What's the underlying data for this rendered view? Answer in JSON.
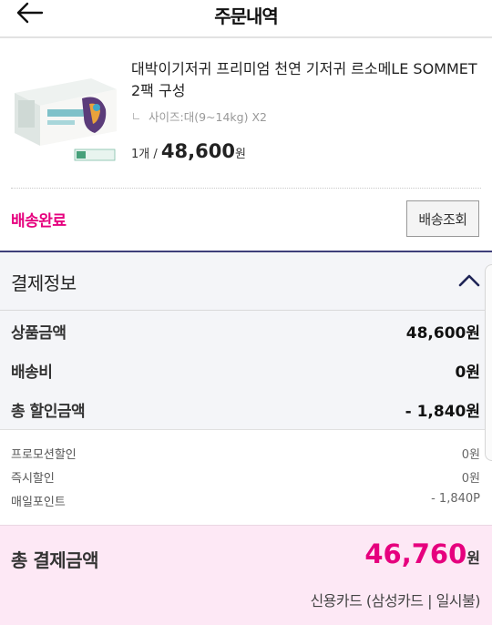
{
  "header": {
    "title": "주문내역",
    "back_icon": "arrow-left-icon"
  },
  "product": {
    "name": "대박이기저귀 프리미엄 천연 기저귀 르소메LE SOMMET 2팩 구성",
    "option": "사이즈:대(9~14kg) X2",
    "quantity": "1개 /",
    "price": "48,600",
    "price_unit": "원"
  },
  "shipping": {
    "status": "배송완료",
    "track_button": "배송조회"
  },
  "payment": {
    "section_title": "결제정보",
    "toggle_icon": "chevron-up-icon",
    "summary": [
      {
        "label": "상품금액",
        "value": "48,600원"
      },
      {
        "label": "배송비",
        "value": "0원"
      },
      {
        "label": "총 할인금액",
        "value": "- 1,840원"
      }
    ],
    "details": [
      {
        "label": "프로모션할인",
        "value": "0원"
      },
      {
        "label": "즉시할인",
        "value": "0원"
      },
      {
        "label": "매일포인트",
        "value": "- 1,840P"
      }
    ],
    "total_label": "총 결제금액",
    "total_amount": "46,760",
    "total_unit": "원",
    "method": "신용카드 (삼성카드 | 일시불)"
  },
  "colors": {
    "accent": "#e6007e",
    "section_border": "#3e3f7a",
    "total_bg": "#fde8f5"
  }
}
